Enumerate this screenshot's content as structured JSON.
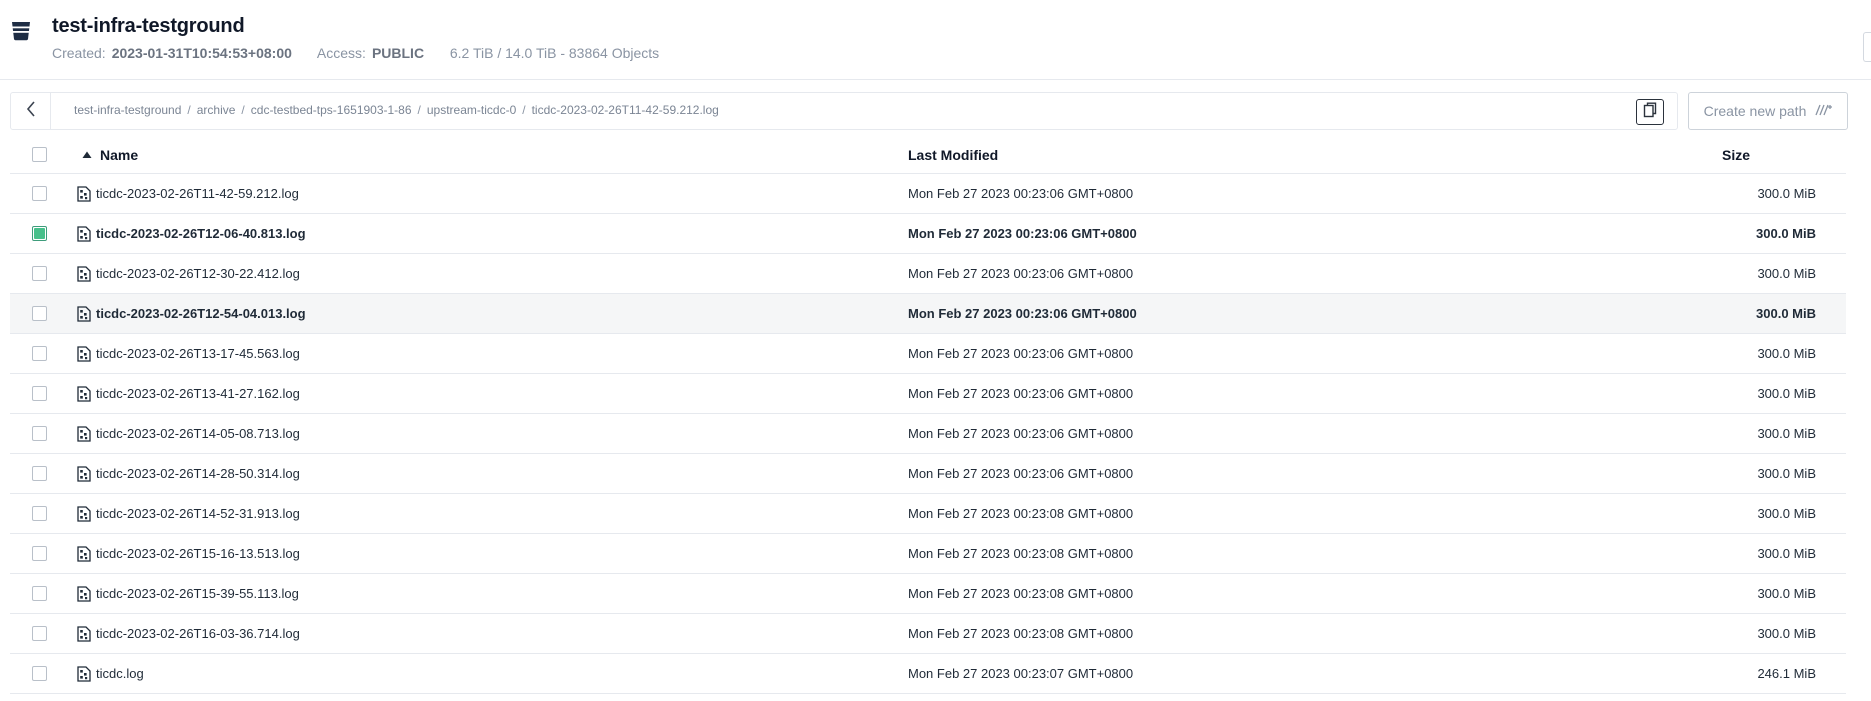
{
  "header": {
    "title": "test-infra-testground",
    "created_label": "Created:",
    "created_value": "2023-01-31T10:54:53+08:00",
    "access_label": "Access:",
    "access_value": "PUBLIC",
    "usage": "6.2 TiB / 14.0 TiB - 83864 Objects",
    "icon": "bucket-icon"
  },
  "breadcrumb": {
    "items": [
      "test-infra-testground",
      "archive",
      "cdc-testbed-tps-1651903-1-86",
      "upstream-ticdc-0",
      "ticdc-2023-02-26T11-42-59.212.log"
    ],
    "separator": "/"
  },
  "toolbar": {
    "create_path_label": "Create new path"
  },
  "table": {
    "columns": {
      "name": "Name",
      "modified": "Last Modified",
      "size": "Size"
    },
    "sort": {
      "column": "name",
      "direction": "ascending"
    },
    "rows": [
      {
        "name": "ticdc-2023-02-26T11-42-59.212.log",
        "modified": "Mon Feb 27 2023 00:23:06 GMT+0800",
        "size": "300.0 MiB",
        "checked": false,
        "state": ""
      },
      {
        "name": "ticdc-2023-02-26T12-06-40.813.log",
        "modified": "Mon Feb 27 2023 00:23:06 GMT+0800",
        "size": "300.0 MiB",
        "checked": true,
        "state": "selected"
      },
      {
        "name": "ticdc-2023-02-26T12-30-22.412.log",
        "modified": "Mon Feb 27 2023 00:23:06 GMT+0800",
        "size": "300.0 MiB",
        "checked": false,
        "state": ""
      },
      {
        "name": "ticdc-2023-02-26T12-54-04.013.log",
        "modified": "Mon Feb 27 2023 00:23:06 GMT+0800",
        "size": "300.0 MiB",
        "checked": false,
        "state": "hovered"
      },
      {
        "name": "ticdc-2023-02-26T13-17-45.563.log",
        "modified": "Mon Feb 27 2023 00:23:06 GMT+0800",
        "size": "300.0 MiB",
        "checked": false,
        "state": ""
      },
      {
        "name": "ticdc-2023-02-26T13-41-27.162.log",
        "modified": "Mon Feb 27 2023 00:23:06 GMT+0800",
        "size": "300.0 MiB",
        "checked": false,
        "state": ""
      },
      {
        "name": "ticdc-2023-02-26T14-05-08.713.log",
        "modified": "Mon Feb 27 2023 00:23:06 GMT+0800",
        "size": "300.0 MiB",
        "checked": false,
        "state": ""
      },
      {
        "name": "ticdc-2023-02-26T14-28-50.314.log",
        "modified": "Mon Feb 27 2023 00:23:06 GMT+0800",
        "size": "300.0 MiB",
        "checked": false,
        "state": ""
      },
      {
        "name": "ticdc-2023-02-26T14-52-31.913.log",
        "modified": "Mon Feb 27 2023 00:23:08 GMT+0800",
        "size": "300.0 MiB",
        "checked": false,
        "state": ""
      },
      {
        "name": "ticdc-2023-02-26T15-16-13.513.log",
        "modified": "Mon Feb 27 2023 00:23:08 GMT+0800",
        "size": "300.0 MiB",
        "checked": false,
        "state": ""
      },
      {
        "name": "ticdc-2023-02-26T15-39-55.113.log",
        "modified": "Mon Feb 27 2023 00:23:08 GMT+0800",
        "size": "300.0 MiB",
        "checked": false,
        "state": ""
      },
      {
        "name": "ticdc-2023-02-26T16-03-36.714.log",
        "modified": "Mon Feb 27 2023 00:23:08 GMT+0800",
        "size": "300.0 MiB",
        "checked": false,
        "state": ""
      },
      {
        "name": "ticdc.log",
        "modified": "Mon Feb 27 2023 00:23:07 GMT+0800",
        "size": "246.1 MiB",
        "checked": false,
        "state": ""
      }
    ]
  },
  "colors": {
    "accent_check": "#47c08b",
    "text": "#1f2a37",
    "muted": "#8a94a3",
    "border": "#e6e9ee",
    "hover_row": "#f5f6f7"
  }
}
